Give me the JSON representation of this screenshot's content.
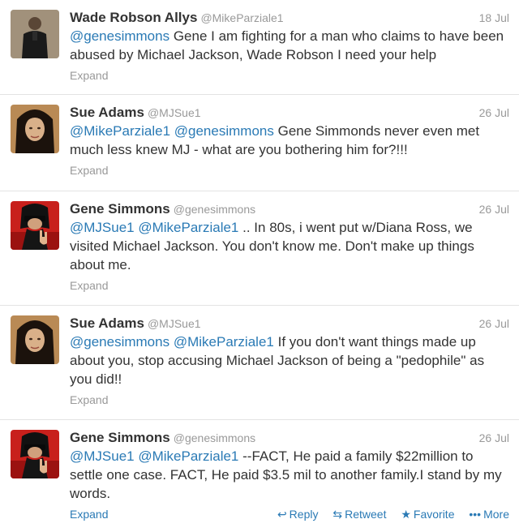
{
  "tweets": [
    {
      "fullname": "Wade Robson Allys",
      "username": "@MikeParziale1",
      "time": "18 Jul",
      "mentions": [
        "@genesimmons"
      ],
      "text": "Gene I am fighting for a man who claims to have been abused by Michael Jackson, Wade Robson I need your help",
      "expand": "Expand",
      "avatar": "avatar-man-dark-suit"
    },
    {
      "fullname": "Sue Adams",
      "username": "@MJSue1",
      "time": "26 Jul",
      "mentions": [
        "@MikeParziale1",
        "@genesimmons"
      ],
      "text": "Gene Simmonds never even met much less knew MJ - what are you bothering him for?!!!",
      "expand": "Expand",
      "avatar": "avatar-portrait"
    },
    {
      "fullname": "Gene Simmons",
      "username": "@genesimmons",
      "time": "26 Jul",
      "mentions": [
        "@MJSue1",
        "@MikeParziale1"
      ],
      "text": ".. In 80s, i went put w/Diana Ross, we visited Michael Jackson. You don't know me. Don't make up things about me.",
      "expand": "Expand",
      "avatar": "avatar-rock-hand"
    },
    {
      "fullname": "Sue Adams",
      "username": "@MJSue1",
      "time": "26 Jul",
      "mentions": [
        "@genesimmons",
        "@MikeParziale1"
      ],
      "text": " If you don't want things made up about you, stop accusing Michael Jackson of being a \"pedophile\" as you did!!",
      "expand": "Expand",
      "avatar": "avatar-portrait"
    },
    {
      "fullname": "Gene Simmons",
      "username": "@genesimmons",
      "time": "26 Jul",
      "mentions": [
        "@MJSue1",
        "@MikeParziale1"
      ],
      "text": "--FACT, He paid a family $22million to settle one case. FACT, He paid $3.5 mil to another family.I stand by my words.",
      "expand": "Expand",
      "avatar": "avatar-rock-hand",
      "actions": {
        "reply": "Reply",
        "retweet": "Retweet",
        "favorite": "Favorite",
        "more": "More"
      }
    }
  ],
  "colors": {
    "link": "#2a7ab5",
    "muted": "#999999",
    "text": "#333333",
    "divider": "#e3e3e3"
  }
}
